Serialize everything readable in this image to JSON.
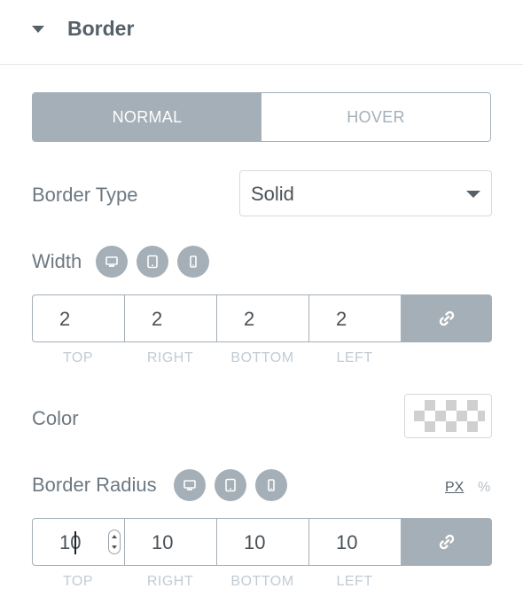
{
  "section": {
    "title": "Border",
    "icon": "caret-down-icon"
  },
  "tabs": [
    {
      "label": "NORMAL",
      "active": true
    },
    {
      "label": "HOVER",
      "active": false
    }
  ],
  "border_type": {
    "label": "Border Type",
    "value": "Solid"
  },
  "width": {
    "label": "Width",
    "devices": [
      "desktop-icon",
      "tablet-icon",
      "mobile-icon"
    ],
    "values": [
      "2",
      "2",
      "2",
      "2"
    ],
    "sides": [
      "TOP",
      "RIGHT",
      "BOTTOM",
      "LEFT"
    ],
    "link_icon": "link-icon"
  },
  "color": {
    "label": "Color",
    "value": "transparent"
  },
  "border_radius": {
    "label": "Border Radius",
    "devices": [
      "desktop-icon",
      "tablet-icon",
      "mobile-icon"
    ],
    "units": [
      "PX",
      "%"
    ],
    "active_unit": "PX",
    "values": [
      "10",
      "10",
      "10",
      "10"
    ],
    "sides": [
      "TOP",
      "RIGHT",
      "BOTTOM",
      "LEFT"
    ],
    "link_icon": "link-icon"
  },
  "colors": {
    "accent": "#a4afb7",
    "text": "#556068",
    "muted": "#c2cbd2"
  }
}
